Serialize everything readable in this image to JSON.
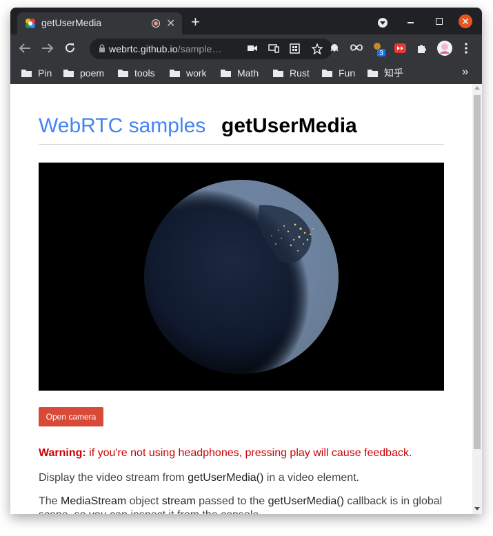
{
  "tab": {
    "title": "getUserMedia",
    "close": "✕"
  },
  "toolbar": {
    "url_host": "webrtc.github.io",
    "url_path": "/sample…",
    "extension_badge": "3"
  },
  "bookmarks": [
    {
      "label": "Pin"
    },
    {
      "label": "poem"
    },
    {
      "label": "tools"
    },
    {
      "label": "work"
    },
    {
      "label": "Math"
    },
    {
      "label": "Rust"
    },
    {
      "label": "Fun"
    },
    {
      "label": "知乎"
    }
  ],
  "bookmarks_more": "»",
  "page": {
    "site_link": "WebRTC samples",
    "title": "getUserMedia",
    "open_camera_label": "Open camera",
    "warning_label": "Warning:",
    "warning_text": " if you're not using headphones, pressing play will cause feedback.",
    "para1": [
      "Display the video stream from ",
      "getUserMedia()",
      " in a video element."
    ],
    "para2": [
      "The ",
      "MediaStream",
      " object ",
      "stream",
      " passed to the ",
      "getUserMedia()",
      " callback is in global scope, so you can inspect it from the console."
    ]
  },
  "colors": {
    "accent_link": "#4285f4",
    "button": "#d84a38",
    "warning": "#cc0000",
    "window_close": "#e95420"
  }
}
